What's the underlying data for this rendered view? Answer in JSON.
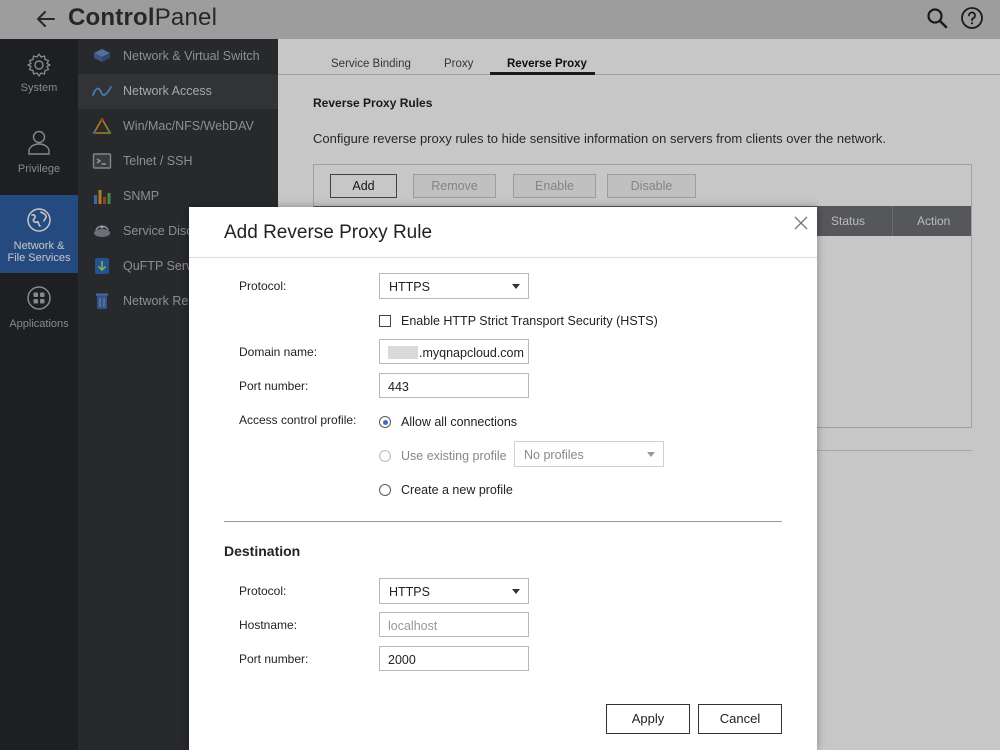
{
  "app": {
    "title_bold": "Control",
    "title_rest": "Panel"
  },
  "icons": {
    "back": "arrow-left-icon",
    "search": "search-icon",
    "help": "help-icon"
  },
  "colors": {
    "accent": "#2f5fa3",
    "radio_selected": "#3a6fc0",
    "sidebar_bg": "#26282d",
    "submenu_bg": "#333539",
    "grid_header_bg": "#6f7074"
  },
  "sidebar": {
    "items": [
      {
        "label": "System",
        "icon": "gear-icon",
        "active": false
      },
      {
        "label": "Privilege",
        "icon": "user-icon",
        "active": false
      },
      {
        "label": "Network &\nFile Services",
        "icon": "globe-icon",
        "active": true
      },
      {
        "label": "Applications",
        "icon": "apps-grid-icon",
        "active": false
      }
    ]
  },
  "submenu": {
    "items": [
      {
        "label": "Network & Virtual Switch",
        "icon": "network-switch-icon"
      },
      {
        "label": "Network Access",
        "icon": "network-access-icon",
        "active": true
      },
      {
        "label": "Win/Mac/NFS/WebDAV",
        "icon": "file-sharing-icon"
      },
      {
        "label": "Telnet / SSH",
        "icon": "terminal-icon"
      },
      {
        "label": "SNMP",
        "icon": "snmp-chart-icon"
      },
      {
        "label": "Service Disc",
        "icon": "service-discovery-icon"
      },
      {
        "label": "QuFTP Servi",
        "icon": "ftp-icon"
      },
      {
        "label": "Network Re",
        "icon": "recycle-bin-icon"
      }
    ]
  },
  "main": {
    "tabs": [
      {
        "label": "Service Binding"
      },
      {
        "label": "Proxy"
      },
      {
        "label": "Reverse Proxy",
        "active": true
      }
    ],
    "section_title": "Reverse Proxy Rules",
    "description": "Configure reverse proxy rules to hide sensitive information on servers from clients over the network.",
    "toolbar": {
      "add": "Add",
      "remove": "Remove",
      "enable": "Enable",
      "disable": "Disable"
    },
    "grid_columns": {
      "status": "Status",
      "action": "Action"
    }
  },
  "dialog": {
    "title": "Add Reverse Proxy Rule",
    "source": {
      "protocol_label": "Protocol:",
      "protocol_value": "HTTPS",
      "hsts_label": "Enable HTTP Strict Transport Security (HSTS)",
      "hsts_checked": false,
      "domain_label": "Domain name:",
      "domain_value": ".myqnapcloud.com",
      "port_label": "Port number:",
      "port_value": "443",
      "access_label": "Access control profile:",
      "access_options": {
        "allow_all": "Allow all connections",
        "use_existing": "Use existing profile",
        "create_new": "Create a new profile"
      },
      "access_selected": "allow_all",
      "profile_select_value": "No profiles"
    },
    "destination": {
      "heading": "Destination",
      "protocol_label": "Protocol:",
      "protocol_value": "HTTPS",
      "hostname_label": "Hostname:",
      "hostname_placeholder": "localhost",
      "port_label": "Port number:",
      "port_value": "2000"
    },
    "buttons": {
      "apply": "Apply",
      "cancel": "Cancel"
    }
  }
}
